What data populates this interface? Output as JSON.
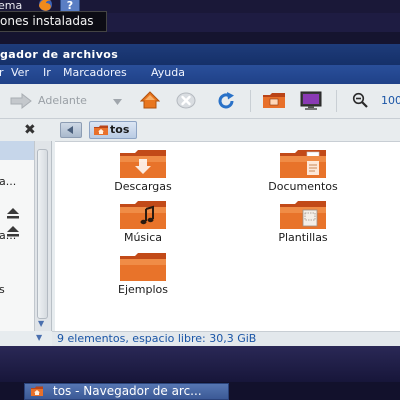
{
  "top_panel": {
    "menu_label": "ema",
    "help_glyph": "?"
  },
  "tooltip": {
    "text": "ones instaladas"
  },
  "window": {
    "title": "gador de archivos",
    "menu": [
      "Ver",
      "Ir",
      "Marcadores",
      "Ayuda"
    ],
    "menu_prefix": "r",
    "toolbar": {
      "forward_label": "Adelante",
      "zoom_label": "100"
    },
    "location": {
      "crumb_label": "tos"
    },
    "sidebar": {
      "close_glyph": "✖",
      "items": [
        {
          "label": ""
        },
        {
          "label": "a..."
        },
        {
          "label": "a..."
        },
        {
          "label": "s"
        }
      ]
    },
    "items": [
      {
        "label": "Descargas",
        "emblem": "download-emblem"
      },
      {
        "label": "Documentos",
        "emblem": "document-emblem"
      },
      {
        "label": "Música",
        "emblem": "music-emblem"
      },
      {
        "label": "Plantillas",
        "emblem": "template-emblem"
      },
      {
        "label": "Ejemplos",
        "emblem": "none"
      }
    ],
    "status": "9 elementos, espacio libre: 30,3 GiB"
  },
  "taskbar": {
    "task_label": "tos - Navegador de arc..."
  },
  "colors": {
    "folder_orange": "#e86a1d",
    "titlebar": "#1e3c7a",
    "link_blue": "#1a55a6"
  }
}
